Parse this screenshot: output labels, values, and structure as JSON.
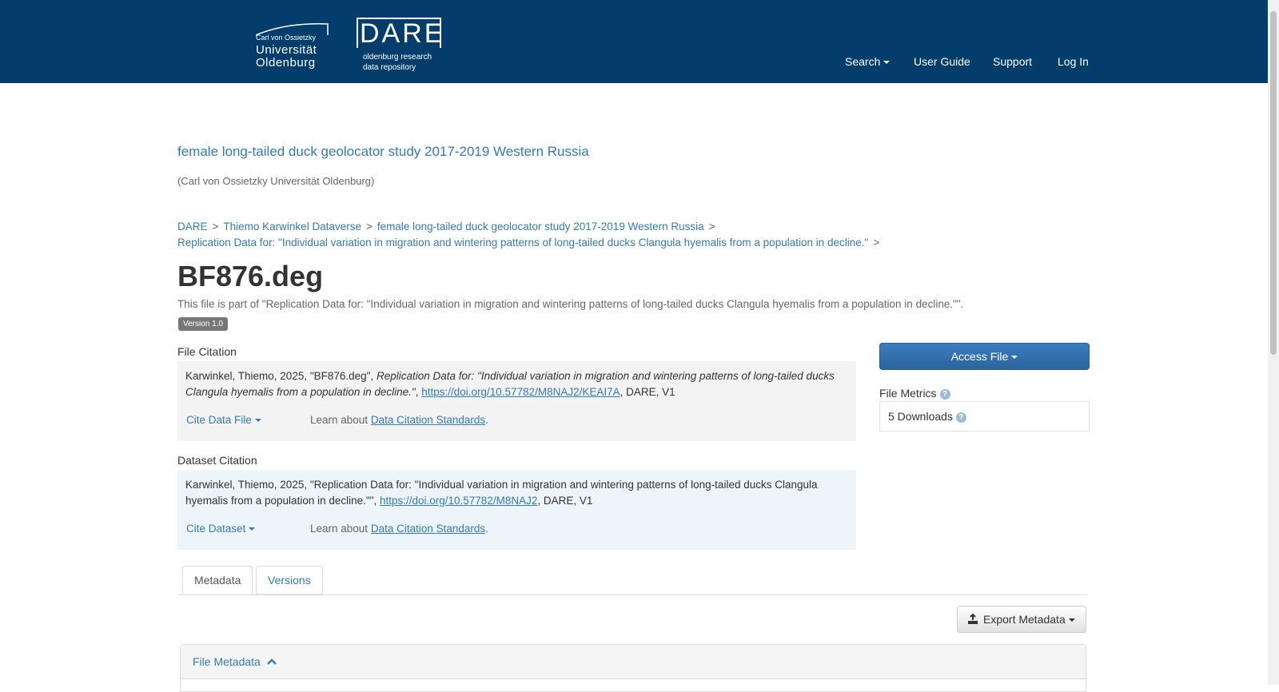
{
  "header": {
    "uni_logo": {
      "line1": "Carl von Ossietzky",
      "line2": "Universität",
      "line3": "Oldenburg"
    },
    "dare_logo": {
      "word": "DARE",
      "sub1": "oldenburg research",
      "sub2": "data repository"
    },
    "nav": {
      "search": "Search",
      "user_guide": "User Guide",
      "support": "Support",
      "login": "Log In"
    }
  },
  "dataverse": {
    "title": "female long-tailed duck geolocator study 2017-2019 Western Russia",
    "affiliation": "(Carl von Ossietzky Universität Oldenburg)"
  },
  "breadcrumbs": {
    "items": [
      "DARE",
      "Thiemo Karwinkel Dataverse",
      "female long-tailed duck geolocator study 2017-2019 Western Russia",
      "Replication Data for: \"Individual variation in migration and wintering patterns of long-tailed ducks Clangula hyemalis from a population in decline.\""
    ],
    "separator": ">"
  },
  "file": {
    "title": "BF876.deg",
    "part_of": "This file is part of \"Replication Data for: \"Individual variation in migration and wintering patterns of long-tailed ducks Clangula hyemalis from a population in decline.\"\".",
    "version": "Version 1.0"
  },
  "file_citation": {
    "label": "File Citation",
    "prefix": "Karwinkel, Thiemo, 2025, \"BF876.deg\", ",
    "italic": "Replication Data for: \"Individual variation in migration and wintering patterns of long-tailed ducks Clangula hyemalis from a population in decline.\"",
    "mid": ", ",
    "doi": "https://doi.org/10.57782/M8NAJ2/KEAI7A",
    "suffix": ", DARE, V1",
    "cite_label": "Cite Data File",
    "learn_text": "Learn about ",
    "learn_link": "Data Citation Standards",
    "learn_end": "."
  },
  "dataset_citation": {
    "label": "Dataset Citation",
    "prefix": "Karwinkel, Thiemo, 2025, \"Replication Data for: \"Individual variation in migration and wintering patterns of long-tailed ducks Clangula hyemalis from a population in decline.\"\", ",
    "doi": "https://doi.org/10.57782/M8NAJ2",
    "suffix": ", DARE, V1",
    "cite_label": "Cite Dataset",
    "learn_text": "Learn about ",
    "learn_link": "Data Citation Standards",
    "learn_end": "."
  },
  "sidebar": {
    "access_label": "Access File",
    "metrics_label": "File Metrics",
    "downloads": "5 Downloads",
    "help_glyph": "?"
  },
  "tabs": {
    "metadata": "Metadata",
    "versions": "Versions"
  },
  "export": {
    "label": "Export Metadata"
  },
  "panel": {
    "title": "File Metadata"
  },
  "colors": {
    "navbar": "#023d6b",
    "link": "#337ab7",
    "file_cite_bg": "#f3f3f3",
    "dataset_cite_bg": "#edf4fa"
  }
}
